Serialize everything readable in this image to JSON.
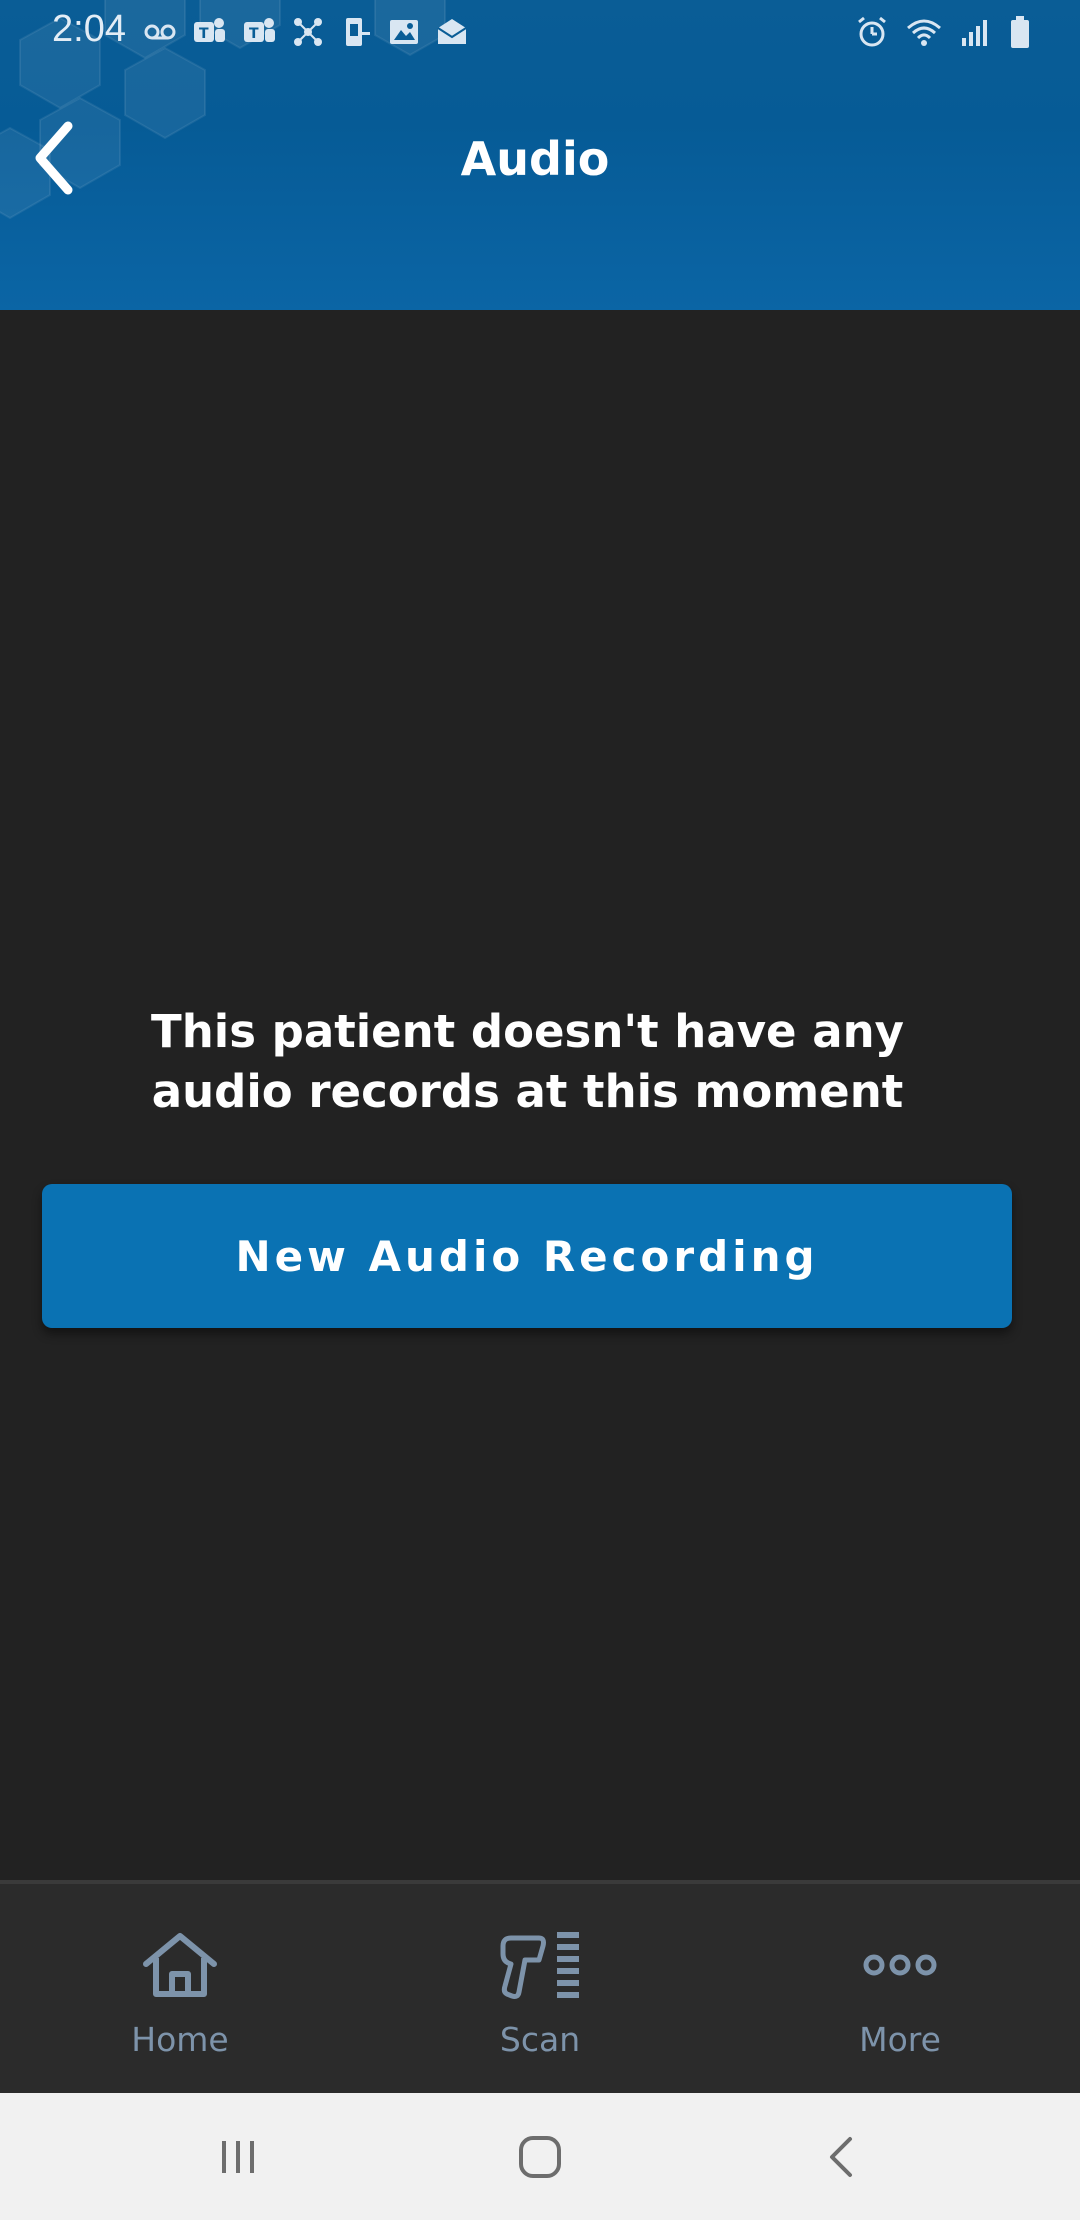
{
  "status_bar": {
    "time": "2:04",
    "left_icons": [
      "voicemail-icon",
      "teams-icon",
      "teams-icon",
      "network-icon",
      "device-icon",
      "image-icon",
      "mail-icon"
    ],
    "right_icons": [
      "alarm-icon",
      "wifi-icon",
      "signal-icon",
      "battery-icon"
    ]
  },
  "header": {
    "title": "Audio",
    "back_icon": "chevron-left-icon",
    "colors": {
      "primary": "#065b96"
    }
  },
  "main": {
    "empty_message_line1": "This patient doesn't have any",
    "empty_message_line2": "audio records at this moment",
    "button_label": "New Audio Recording",
    "button_color": "#0a72b3"
  },
  "bottom_nav": {
    "items": [
      {
        "label": "Home",
        "icon": "home-icon"
      },
      {
        "label": "Scan",
        "icon": "barcode-scanner-icon"
      },
      {
        "label": "More",
        "icon": "more-dots-icon"
      }
    ],
    "label_color": "#7d93aa"
  },
  "system_nav": {
    "buttons": [
      "recent-apps-icon",
      "home-circle-icon",
      "system-back-icon"
    ]
  }
}
